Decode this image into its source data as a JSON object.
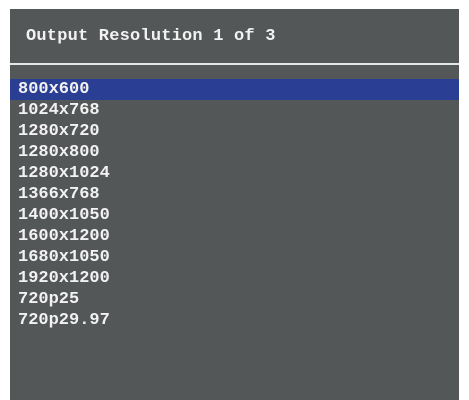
{
  "dialog": {
    "title": "Output Resolution 1 of 3"
  },
  "options": [
    {
      "label": "800x600",
      "selected": true
    },
    {
      "label": "1024x768",
      "selected": false
    },
    {
      "label": "1280x720",
      "selected": false
    },
    {
      "label": "1280x800",
      "selected": false
    },
    {
      "label": "1280x1024",
      "selected": false
    },
    {
      "label": "1366x768",
      "selected": false
    },
    {
      "label": "1400x1050",
      "selected": false
    },
    {
      "label": "1600x1200",
      "selected": false
    },
    {
      "label": "1680x1050",
      "selected": false
    },
    {
      "label": "1920x1200",
      "selected": false
    },
    {
      "label": "720p25",
      "selected": false
    },
    {
      "label": "720p29.97",
      "selected": false
    }
  ],
  "colors": {
    "panel_background": "#545758",
    "selection_highlight": "#2a3f93",
    "text": "#f2f2f2",
    "divider": "#e6e6e6"
  }
}
